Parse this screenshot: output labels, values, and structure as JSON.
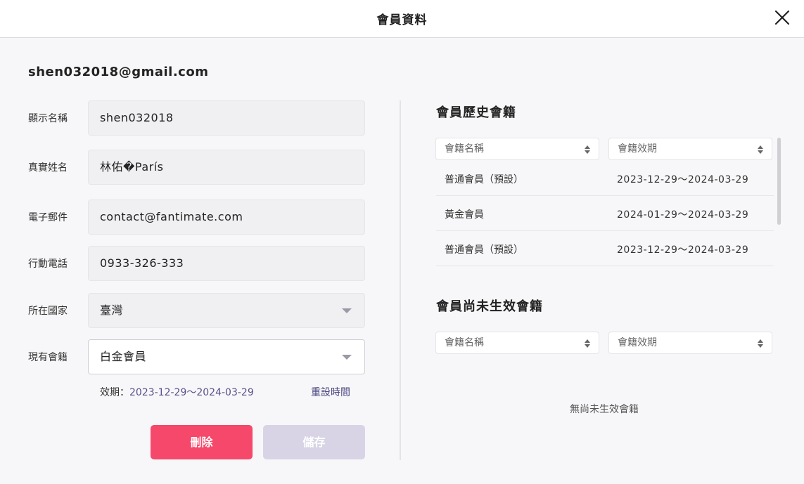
{
  "header": {
    "title": "會員資料"
  },
  "member": {
    "email": "shen032018@gmail.com"
  },
  "form": {
    "display_name": {
      "label": "顯示名稱",
      "value": "shen032018"
    },
    "real_name": {
      "label": "真實姓名",
      "value": "林佑�París"
    },
    "email": {
      "label": "電子郵件",
      "value": "contact@fantimate.com"
    },
    "phone": {
      "label": "行動電話",
      "value": "0933-326-333"
    },
    "country": {
      "label": "所在國家",
      "value": "臺灣"
    },
    "membership": {
      "label": "現有會籍",
      "value": "白金會員"
    },
    "validity_label": "效期：",
    "validity_value": "2023-12-29～2024-03-29",
    "reset_label": "重設時間"
  },
  "actions": {
    "delete_label": "刪除",
    "save_label": "儲存"
  },
  "history": {
    "title": "會員歷史會籍",
    "columns": [
      "會籍名稱",
      "會籍效期"
    ],
    "rows": [
      {
        "name": "普通會員（預設）",
        "period": "2023-12-29～2024-03-29"
      },
      {
        "name": "黃金會員",
        "period": "2024-01-29～2024-03-29"
      },
      {
        "name": "普通會員（預設）",
        "period": "2023-12-29～2024-03-29"
      }
    ]
  },
  "pending": {
    "title": "會員尚未生效會籍",
    "columns": [
      "會籍名稱",
      "會籍效期"
    ],
    "empty_text": "無尚未生效會籍"
  }
}
